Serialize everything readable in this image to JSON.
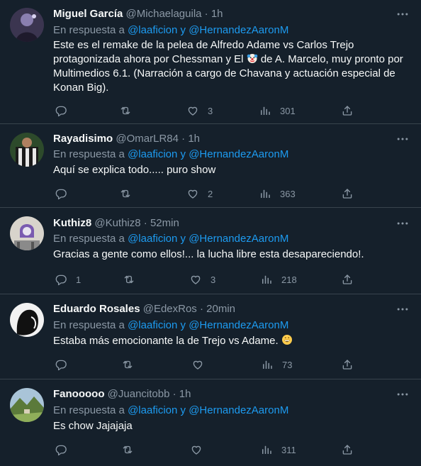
{
  "reply_prefix": "En respuesta a",
  "reply_conj": "y",
  "mention1": "@laaficion",
  "mention2": "@HernandezAaronM",
  "tweets": [
    {
      "name": "Miguel García",
      "handle": "@Michaelaguila",
      "sep": "·",
      "time": "1h",
      "text_part1": "Este es el remake de la pelea de Alfredo Adame vs Carlos Trejo protagonizada ahora por Chessman y El",
      "text_emoji": "clown-face-emoji",
      "text_part2": "de A. Marcelo, muy pronto por Multimedios 6.1. (Narración a cargo de Chavana y actuación especial de Konan Big).",
      "replies": "",
      "likes": "3",
      "views": "301"
    },
    {
      "name": "Rayadisimo",
      "handle": "@OmarLR84",
      "sep": "·",
      "time": "1h",
      "text": "Aquí se explica todo..... puro show",
      "replies": "",
      "likes": "2",
      "views": "363"
    },
    {
      "name": "Kuthiz8",
      "handle": "@Kuthiz8",
      "sep": "·",
      "time": "52min",
      "text": "Gracias a gente como ellos!... la lucha libre esta desapareciendo!.",
      "replies": "1",
      "likes": "3",
      "views": "218"
    },
    {
      "name": "Eduardo Rosales",
      "handle": "@EdexRos",
      "sep": "·",
      "time": "20min",
      "text": "Estaba más emocionante la de Trejo vs Adame.",
      "text_emoji": "grinning-face-emoji",
      "replies": "",
      "likes": "",
      "views": "73"
    },
    {
      "name": "Fanooooo",
      "handle": "@Juancitobb",
      "sep": "·",
      "time": "1h",
      "text": "Es chow Jajajaja",
      "replies": "",
      "likes": "",
      "views": "311"
    }
  ],
  "colors": {
    "background": "#15202b",
    "text": "#f7f9f9",
    "muted": "#8b98a5",
    "accent": "#1d9bf0",
    "divider": "#38444d"
  }
}
